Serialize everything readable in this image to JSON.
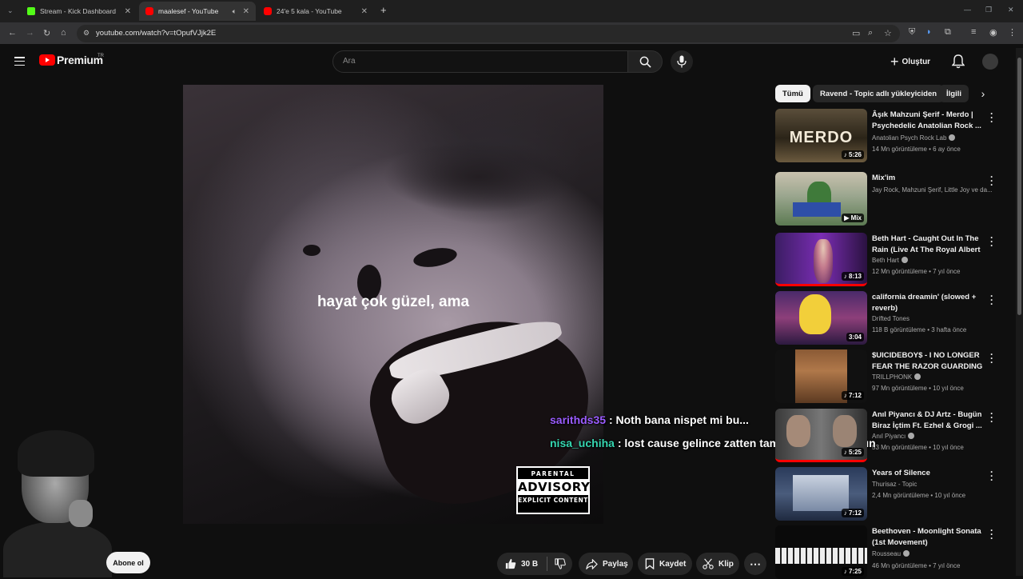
{
  "browser": {
    "tabs": [
      {
        "title": "Stream - Kick Dashboard",
        "favicon": "kick-icon",
        "color": "#53fc18"
      },
      {
        "title": "maalesef - YouTube",
        "favicon": "youtube-icon",
        "color": "#ff0000"
      },
      {
        "title": "24'e 5 kala - YouTube",
        "favicon": "youtube-icon",
        "color": "#ff0000"
      }
    ],
    "url": "youtube.com/watch?v=tOpufVJjk2E"
  },
  "header": {
    "logo_text": "Premium",
    "country": "TR",
    "search_placeholder": "Ara",
    "create_label": "Oluştur"
  },
  "video": {
    "lyric": "hayat çok güzel, ama",
    "advisory": {
      "line1": "PARENTAL",
      "line2": "ADVISORY",
      "line3": "EXPLICIT CONTENT"
    }
  },
  "chat": [
    {
      "user": "sarithds35",
      "message": ": Noth bana nispet mi bu...",
      "color": "#9b5cff"
    },
    {
      "user": "nisa_uchiha",
      "message": ": lost cause gelince zatten tamamen kopuyorsun",
      "color": "#35d6b0"
    }
  ],
  "subscribe_label": "Abone ol",
  "actions": {
    "likes": "30 B",
    "share": "Paylaş",
    "save": "Kaydet",
    "clip": "Klip"
  },
  "chips": [
    "Tümü",
    "Ravend - Topic adlı yükleyiciden",
    "İlgili"
  ],
  "recommendations": [
    {
      "title": "Âşık Mahzuni Şerif - Merdo | Psychedelic Anatolian Rock ...",
      "channel": "Anatolian Psych Rock Lab",
      "verified": true,
      "meta": "14 Mn görüntüleme • 6 ay önce",
      "duration": "5:26",
      "thumb_text": "MERDO"
    },
    {
      "title": "Mix'im",
      "channel": "Jay Rock, Mahzuni Şerif, Little Joy ve da...",
      "verified": false,
      "meta": "",
      "duration": "Mix",
      "thumb_text": ""
    },
    {
      "title": "Beth Hart - Caught Out In The Rain (Live At The Royal Albert ...",
      "channel": "Beth Hart",
      "verified": true,
      "meta": "12 Mn görüntüleme • 7 yıl önce",
      "duration": "8:13",
      "thumb_text": ""
    },
    {
      "title": "california dreamin' (slowed + reverb)",
      "channel": "Drifted Tones",
      "verified": false,
      "meta": "118 B görüntüleme • 3 hafta önce",
      "duration": "3:04",
      "thumb_text": ""
    },
    {
      "title": "$UICIDEBOY$ - I NO LONGER FEAR THE RAZOR GUARDING ...",
      "channel": "TRILLPHONK",
      "verified": true,
      "meta": "97 Mn görüntüleme • 10 yıl önce",
      "duration": "7:12",
      "thumb_text": ""
    },
    {
      "title": "Anıl Piyancı & DJ Artz - Bugün Biraz İçtim Ft. Ezhel & Grogi ...",
      "channel": "Anıl Piyancı",
      "verified": true,
      "meta": "53 Mn görüntüleme • 10 yıl önce",
      "duration": "5:25",
      "thumb_text": ""
    },
    {
      "title": "Years of Silence",
      "channel": "Thurisaz - Topic",
      "verified": false,
      "meta": "2,4 Mn görüntüleme • 10 yıl önce",
      "duration": "7:12",
      "thumb_text": ""
    },
    {
      "title": "Beethoven - Moonlight Sonata (1st Movement)",
      "channel": "Rousseau",
      "verified": true,
      "meta": "46 Mn görüntüleme • 7 yıl önce",
      "duration": "7:25",
      "thumb_text": ""
    }
  ]
}
